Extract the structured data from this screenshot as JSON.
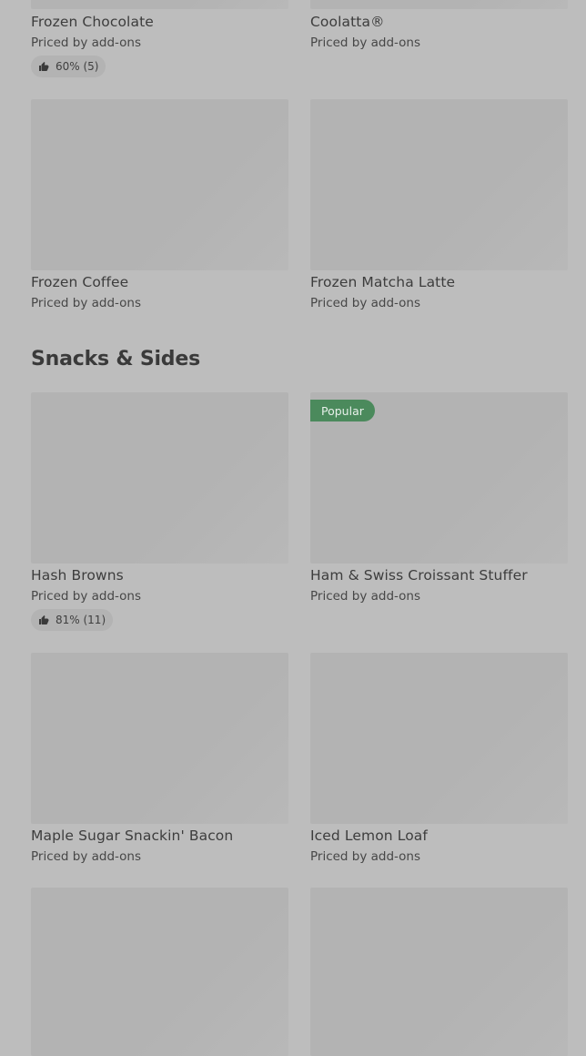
{
  "prev_section": {
    "items": [
      {
        "name": "Frozen Chocolate",
        "price": "Priced by add-ons",
        "rating": "60% (5)"
      },
      {
        "name": "Coolatta®",
        "price": "Priced by add-ons"
      },
      {
        "name": "Frozen Coffee",
        "price": "Priced by add-ons"
      },
      {
        "name": "Frozen Matcha Latte",
        "price": "Priced by add-ons"
      }
    ]
  },
  "snacks_section": {
    "title": "Snacks & Sides",
    "items": [
      {
        "name": "Hash Browns",
        "price": "Priced by add-ons",
        "rating": "81% (11)"
      },
      {
        "name": "Ham & Swiss Croissant Stuffer",
        "price": "Priced by add-ons",
        "badge": "Popular"
      },
      {
        "name": "Maple Sugar Snackin' Bacon",
        "price": "Priced by add-ons"
      },
      {
        "name": "Iced Lemon Loaf",
        "price": "Priced by add-ons"
      }
    ]
  },
  "icons": {
    "rating": "thumbs-up-icon"
  }
}
